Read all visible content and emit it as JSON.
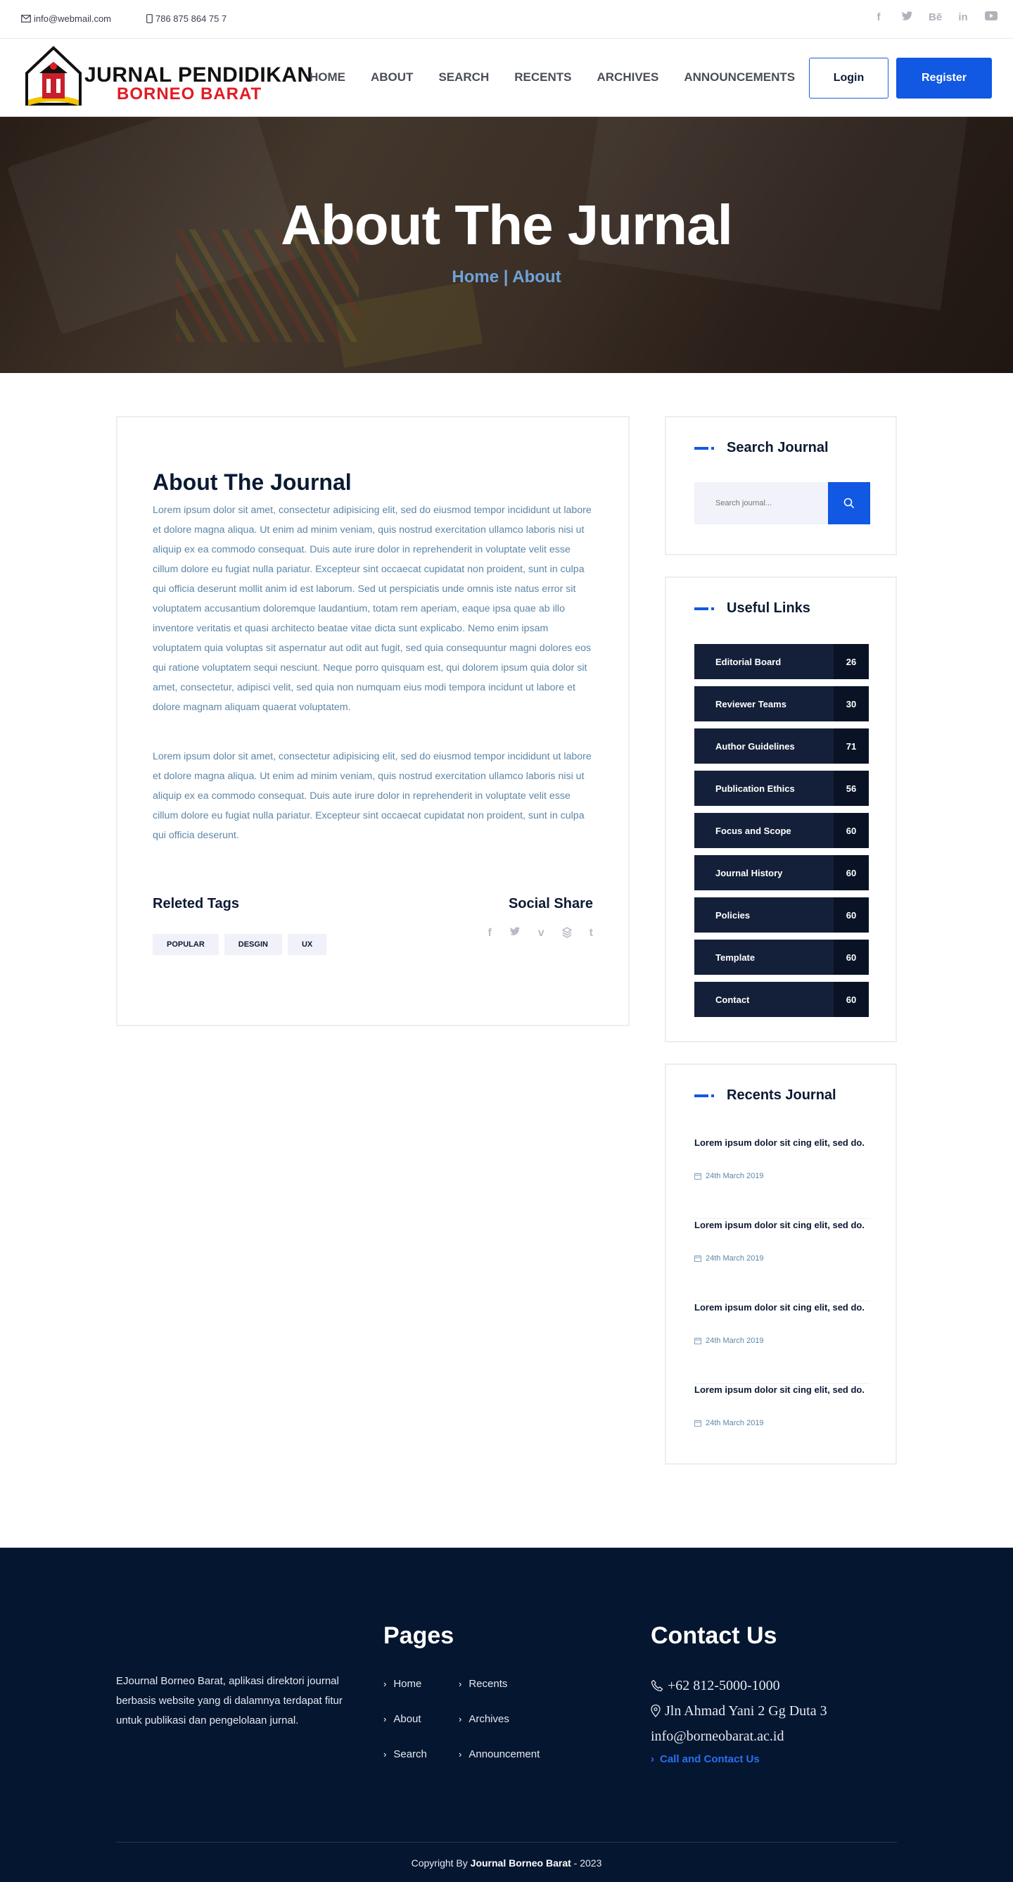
{
  "topbar": {
    "email": "info@webmail.com",
    "phone": "786 875 864 75 7",
    "socials": [
      "facebook-icon",
      "twitter-icon",
      "behance-icon",
      "linkedin-icon",
      "youtube-icon"
    ]
  },
  "header": {
    "logo_line1": "JURNAL PENDIDIKAN",
    "logo_line2": "BORNEO BARAT",
    "nav": [
      "HOME",
      "ABOUT",
      "SEARCH",
      "RECENTS",
      "ARCHIVES",
      "ANNOUNCEMENTS"
    ],
    "login_label": "Login",
    "register_label": "Register"
  },
  "hero": {
    "title": "About The Jurnal",
    "breadcrumb": "Home | About"
  },
  "article": {
    "title": "About The Journal",
    "paragraph1": "Lorem ipsum dolor sit amet, consectetur adipisicing elit, sed do eiusmod tempor incididunt ut labore et dolore magna aliqua. Ut enim ad minim veniam, quis nostrud exercitation ullamco laboris nisi ut aliquip ex ea commodo consequat. Duis aute irure dolor in reprehenderit in voluptate velit esse cillum dolore eu fugiat nulla pariatur. Excepteur sint occaecat cupidatat non proident, sunt in culpa qui officia deserunt mollit anim id est laborum. Sed ut perspiciatis unde omnis iste natus error sit voluptatem accusantium doloremque laudantium, totam rem aperiam, eaque ipsa quae ab illo inventore veritatis et quasi architecto beatae vitae dicta sunt explicabo. Nemo enim ipsam voluptatem quia voluptas sit aspernatur aut odit aut fugit, sed quia consequuntur magni dolores eos qui ratione voluptatem sequi nesciunt. Neque porro quisquam est, qui dolorem ipsum quia dolor sit amet, consectetur, adipisci velit, sed quia non numquam eius modi tempora incidunt ut labore et dolore magnam aliquam quaerat voluptatem.",
    "paragraph2": "Lorem ipsum dolor sit amet, consectetur adipisicing elit, sed do eiusmod tempor incididunt ut labore et dolore magna aliqua. Ut enim ad minim veniam, quis nostrud exercitation ullamco laboris nisi ut aliquip ex ea commodo consequat. Duis aute irure dolor in reprehenderit in voluptate velit esse cillum dolore eu fugiat nulla pariatur. Excepteur sint occaecat cupidatat non proident, sunt in culpa qui officia deserunt.",
    "tags_title": "Releted Tags",
    "tags": [
      "POPULAR",
      "DESGIN",
      "UX"
    ],
    "share_title": "Social Share",
    "share_icons": [
      "facebook-icon",
      "twitter-icon",
      "vimeo-icon",
      "stack-icon",
      "tumblr-icon"
    ]
  },
  "sidebar": {
    "search": {
      "title": "Search Journal",
      "placeholder": "Search journal..."
    },
    "links": {
      "title": "Useful Links",
      "items": [
        {
          "label": "Editorial Board",
          "count": "26"
        },
        {
          "label": "Reviewer Teams",
          "count": "30"
        },
        {
          "label": "Author Guidelines",
          "count": "71"
        },
        {
          "label": "Publication Ethics",
          "count": "56"
        },
        {
          "label": "Focus and Scope",
          "count": "60"
        },
        {
          "label": "Journal History",
          "count": "60"
        },
        {
          "label": "Policies",
          "count": "60"
        },
        {
          "label": "Template",
          "count": "60"
        },
        {
          "label": "Contact",
          "count": "60"
        }
      ]
    },
    "recents": {
      "title": "Recents Journal",
      "items": [
        {
          "title": "Lorem ipsum dolor sit cing elit, sed do.",
          "date": "24th March 2019"
        },
        {
          "title": "Lorem ipsum dolor sit cing elit, sed do.",
          "date": "24th March 2019"
        },
        {
          "title": "Lorem ipsum dolor sit cing elit, sed do.",
          "date": "24th March 2019"
        },
        {
          "title": "Lorem ipsum dolor sit cing elit, sed do.",
          "date": "24th March 2019"
        }
      ]
    }
  },
  "footer": {
    "about": "EJournal Borneo Barat, aplikasi direktori journal berbasis website yang di dalamnya terdapat fitur untuk publikasi dan pengelolaan jurnal.",
    "pages_title": "Pages",
    "pages": [
      "Home",
      "Recents",
      "About",
      "Archives",
      "Search",
      "Announcement"
    ],
    "contact_title": "Contact Us",
    "phone": "+62 812-5000-1000",
    "address": "Jln Ahmad Yani 2 Gg Duta 3",
    "email": "info@borneobarat.ac.id",
    "cta": "Call and Contact Us",
    "copyright_prefix": "Copyright By ",
    "copyright_name": "Journal Borneo Barat",
    "copyright_suffix": " - 2023"
  },
  "colors": {
    "accent": "#1158e3",
    "navy": "#142039",
    "footer_bg": "#051630",
    "body_text": "#5d86a6",
    "logo_red": "#e21b23"
  }
}
